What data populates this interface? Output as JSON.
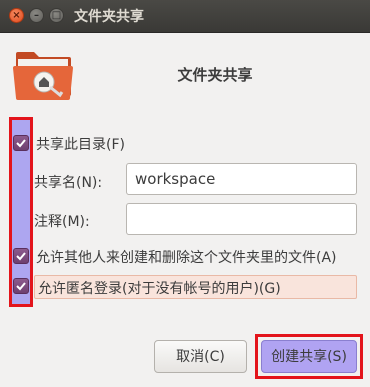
{
  "window": {
    "title": "文件夹共享",
    "controls": [
      "close-icon",
      "minimize-icon",
      "maximize-icon"
    ]
  },
  "header": {
    "icon": "shared-folder-icon",
    "title": "文件夹共享"
  },
  "share_checkbox": {
    "label": "共享此目录(F)",
    "checked": true
  },
  "share_name": {
    "label": "共享名(N):",
    "value": "workspace"
  },
  "comment": {
    "label": "注释(M):",
    "value": ""
  },
  "allow_others_checkbox": {
    "label": "允许其他人来创建和删除这个文件夹里的文件(A)",
    "checked": true
  },
  "guest_checkbox": {
    "label": "允许匿名登录(对于没有帐号的用户)(G)",
    "checked": true
  },
  "buttons": {
    "cancel": "取消(C)",
    "create": "创建共享(S)"
  },
  "colors": {
    "titlebar": "#3c3b37",
    "checkbox": "#77477a",
    "highlight_border": "#e3141b",
    "highlight_fill": "#968cf0",
    "guest_row_bg": "#f9e4dc",
    "folder_orange": "#e5663a"
  }
}
